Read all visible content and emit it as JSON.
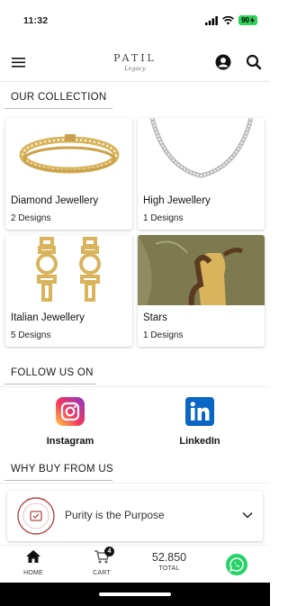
{
  "status_bar": {
    "time": "11:32",
    "battery": "90",
    "icons": [
      "signal-icon",
      "wifi-icon",
      "battery-icon"
    ]
  },
  "header": {
    "logo_main": "PATIL",
    "logo_sub": "Legacy",
    "icons": [
      "menu-icon",
      "account-icon",
      "search-icon"
    ]
  },
  "collection": {
    "title": "OUR COLLECTION",
    "items": [
      {
        "name": "Diamond Jewellery",
        "count": "2 Designs"
      },
      {
        "name": "High Jewellery",
        "count": "1 Designs"
      },
      {
        "name": "Italian Jewellery",
        "count": "5 Designs"
      },
      {
        "name": "Stars",
        "count": "1 Designs"
      }
    ]
  },
  "follow": {
    "title": "FOLLOW US ON",
    "items": [
      {
        "label": "Instagram",
        "icon": "instagram-icon"
      },
      {
        "label": "LinkedIn",
        "icon": "linkedin-icon"
      }
    ]
  },
  "why": {
    "title": "WHY BUY FROM US",
    "item_label": "Purity is the Purpose"
  },
  "bottom_nav": {
    "home": "HOME",
    "cart": "CART",
    "cart_count": "4",
    "total_value": "52.850",
    "total": "TOTAL"
  },
  "colors": {
    "accent": "#1a1a1a",
    "whatsapp": "#25d366",
    "battery": "#2fd158",
    "gold": "#d9b45c"
  }
}
